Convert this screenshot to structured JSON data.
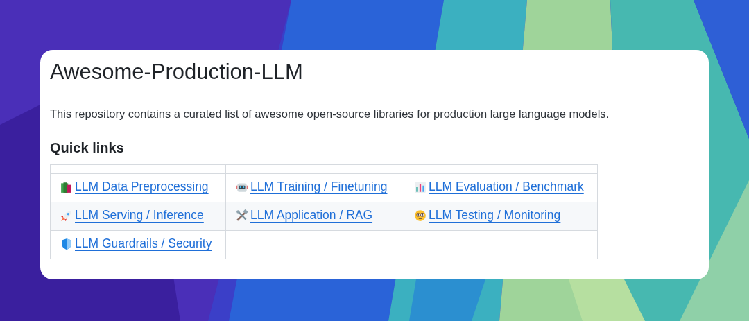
{
  "title": "Awesome-Production-LLM",
  "description": "This repository contains a curated list of awesome open-source libraries for production large language models.",
  "section_heading": "Quick links",
  "table": {
    "rows": [
      [
        "LLM Data Preprocessing",
        "LLM Training / Finetuning",
        "LLM Evaluation / Benchmark"
      ],
      [
        "LLM Serving / Inference",
        "LLM Application / RAG",
        "LLM Testing / Monitoring"
      ],
      [
        "LLM Guardrails / Security"
      ]
    ]
  }
}
